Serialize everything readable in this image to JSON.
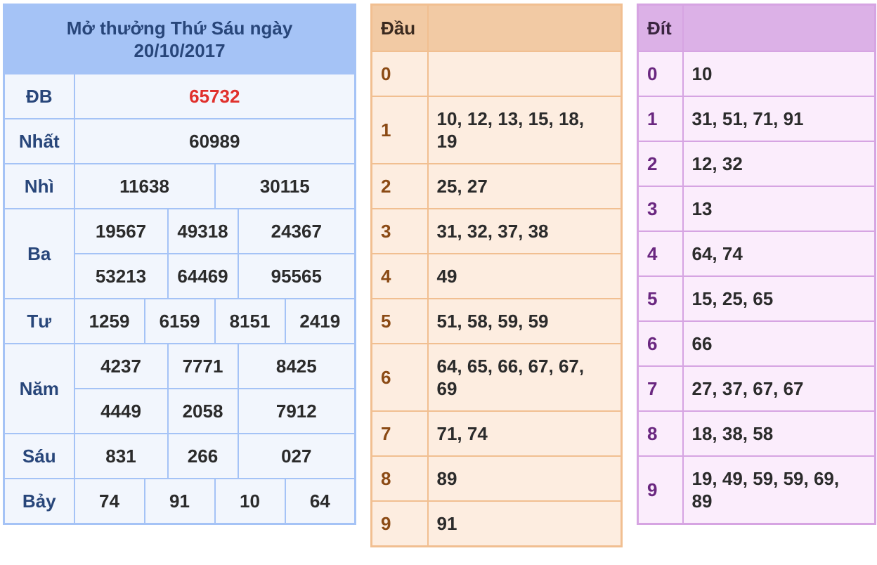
{
  "results": {
    "title_line1": "Mở thưởng Thứ Sáu ngày",
    "title_line2": "20/10/2017",
    "rows": {
      "db": {
        "label": "ĐB",
        "values": [
          "65732"
        ]
      },
      "nhat": {
        "label": "Nhất",
        "values": [
          "60989"
        ]
      },
      "nhi": {
        "label": "Nhì",
        "values": [
          "11638",
          "30115"
        ]
      },
      "ba": {
        "label": "Ba",
        "values": [
          "19567",
          "49318",
          "24367",
          "53213",
          "64469",
          "95565"
        ]
      },
      "tu": {
        "label": "Tư",
        "values": [
          "1259",
          "6159",
          "8151",
          "2419"
        ]
      },
      "nam": {
        "label": "Năm",
        "values": [
          "4237",
          "7771",
          "8425",
          "4449",
          "2058",
          "7912"
        ]
      },
      "sau": {
        "label": "Sáu",
        "values": [
          "831",
          "266",
          "027"
        ]
      },
      "bay": {
        "label": "Bảy",
        "values": [
          "74",
          "91",
          "10",
          "64"
        ]
      }
    }
  },
  "dau": {
    "header": "Đầu",
    "rows": [
      {
        "key": "0",
        "values": ""
      },
      {
        "key": "1",
        "values": "10, 12, 13, 15, 18, 19"
      },
      {
        "key": "2",
        "values": "25, 27"
      },
      {
        "key": "3",
        "values": "31, 32, 37, 38"
      },
      {
        "key": "4",
        "values": "49"
      },
      {
        "key": "5",
        "values": "51, 58, 59, 59"
      },
      {
        "key": "6",
        "values": "64, 65, 66, 67, 67, 69"
      },
      {
        "key": "7",
        "values": "71, 74"
      },
      {
        "key": "8",
        "values": "89"
      },
      {
        "key": "9",
        "values": "91"
      }
    ]
  },
  "dit": {
    "header": "Đít",
    "rows": [
      {
        "key": "0",
        "values": "10"
      },
      {
        "key": "1",
        "values": "31, 51, 71, 91"
      },
      {
        "key": "2",
        "values": "12, 32"
      },
      {
        "key": "3",
        "values": "13"
      },
      {
        "key": "4",
        "values": "64, 74"
      },
      {
        "key": "5",
        "values": "15, 25, 65"
      },
      {
        "key": "6",
        "values": "66"
      },
      {
        "key": "7",
        "values": "27, 37, 67, 67"
      },
      {
        "key": "8",
        "values": "18, 38, 58"
      },
      {
        "key": "9",
        "values": "19, 49, 59, 59, 69, 89"
      }
    ]
  },
  "colors": {
    "results_border": "#a5c3f6",
    "special_prize": "#e0302c",
    "dau_border": "#f1bf91",
    "dit_border": "#d6a4e2"
  }
}
